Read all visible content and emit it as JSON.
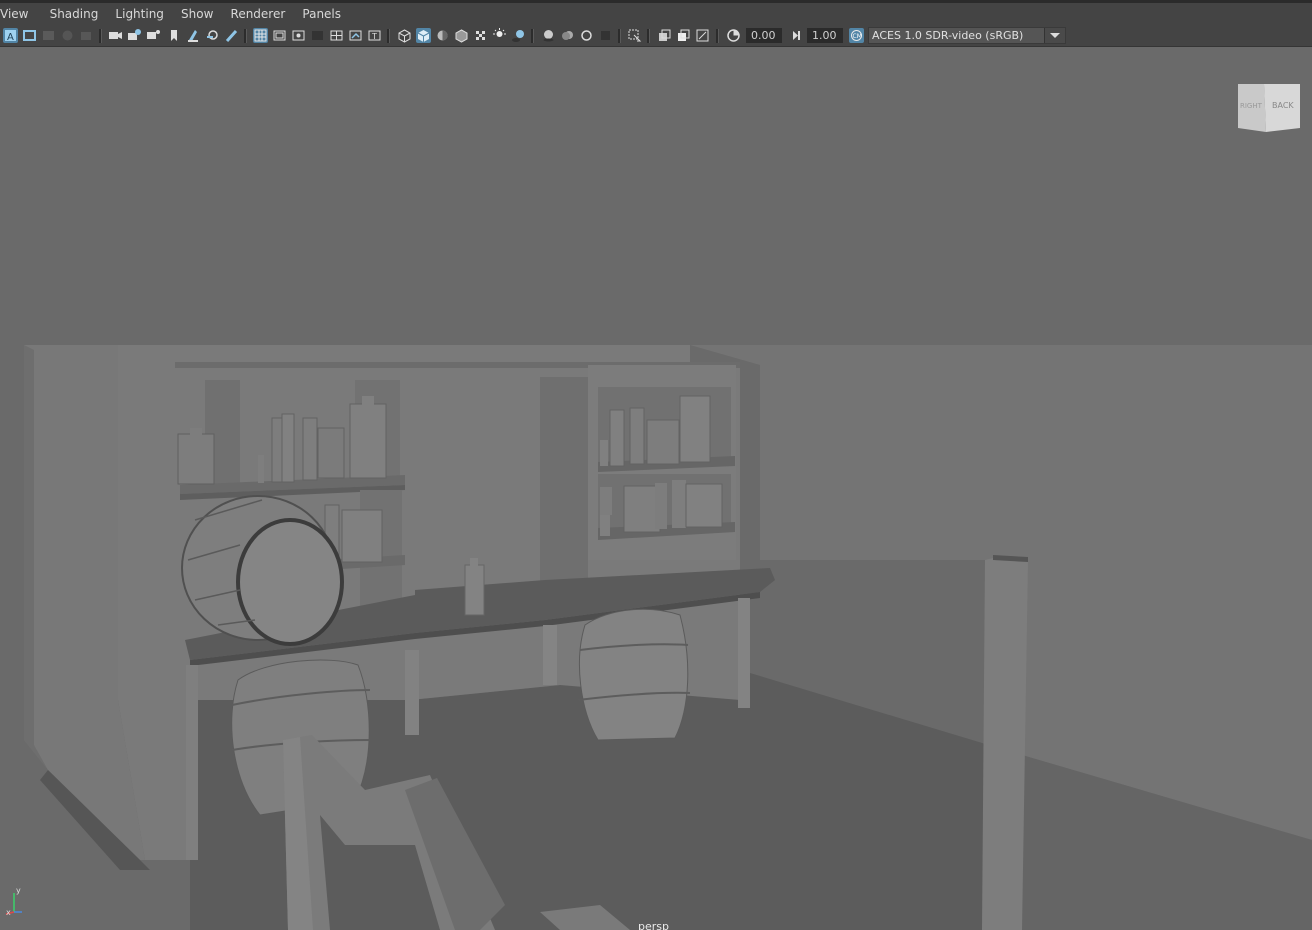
{
  "menu": {
    "items": [
      "View",
      "Shading",
      "Lighting",
      "Show",
      "Renderer",
      "Panels"
    ]
  },
  "toolbar": {
    "icons": [
      "select-camera-icon",
      "camera-attributes-icon",
      "bookmark-icon",
      "image-plane-icon",
      "grease-pencil-icon",
      "lock-camera-icon",
      "camera-attrs-icon",
      "bookmarks-icon",
      "image-plane-2-icon",
      "2d-pan-zoom-icon",
      "grease-pencil-2-icon",
      "grid-icon",
      "film-gate-icon",
      "resolution-gate-icon",
      "gate-mask-icon",
      "field-chart-icon",
      "safe-action-icon",
      "safe-title-icon",
      "wireframe-icon",
      "smooth-shade-icon",
      "default-material-icon",
      "wireframe-on-shaded-icon",
      "textured-icon",
      "use-all-lights-icon",
      "shadows-icon",
      "screen-space-ao-icon",
      "motion-blur-icon",
      "multisample-aa-icon",
      "depth-of-field-icon",
      "isolate-select-icon",
      "xray-icon",
      "xray-joints-icon",
      "backface-culling-icon",
      "exposure-icon",
      "gamma-icon",
      "color-management-icon"
    ],
    "exposure_value": "0.00",
    "gamma_value": "1.00",
    "colorspace": "ACES 1.0 SDR-video (sRGB)"
  },
  "viewcube": {
    "face_right": "RIGHT",
    "face_back": "BACK"
  },
  "viewport": {
    "camera_label": "persp",
    "axis_labels": {
      "y": "y",
      "x": "x"
    }
  },
  "colors": {
    "ui_bg": "#444444",
    "viewport_bg": "#6a6a6a",
    "accent": "#5285a6"
  }
}
